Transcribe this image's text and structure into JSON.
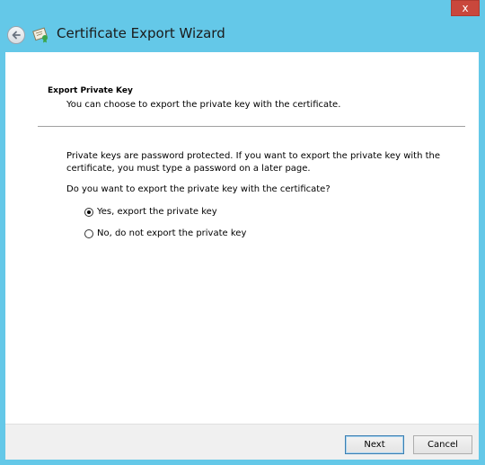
{
  "window": {
    "title": "Certificate Export Wizard",
    "close_glyph": "x",
    "accent_color": "#64c8e8",
    "close_color": "#c9473c"
  },
  "icons": {
    "back": "back-arrow-icon",
    "app": "certificate-icon",
    "close": "close-icon"
  },
  "section": {
    "heading": "Export Private Key",
    "subheading": "You can choose to export the private key with the certificate."
  },
  "body": {
    "paragraph": "Private keys are password protected. If you want to export the private key with the certificate, you must type a password on a later page.",
    "question": "Do you want to export the private key with the certificate?"
  },
  "options": [
    {
      "label": "Yes, export the private key",
      "selected": true
    },
    {
      "label": "No, do not export the private key",
      "selected": false
    }
  ],
  "footer": {
    "next_label": "Next",
    "cancel_label": "Cancel"
  }
}
